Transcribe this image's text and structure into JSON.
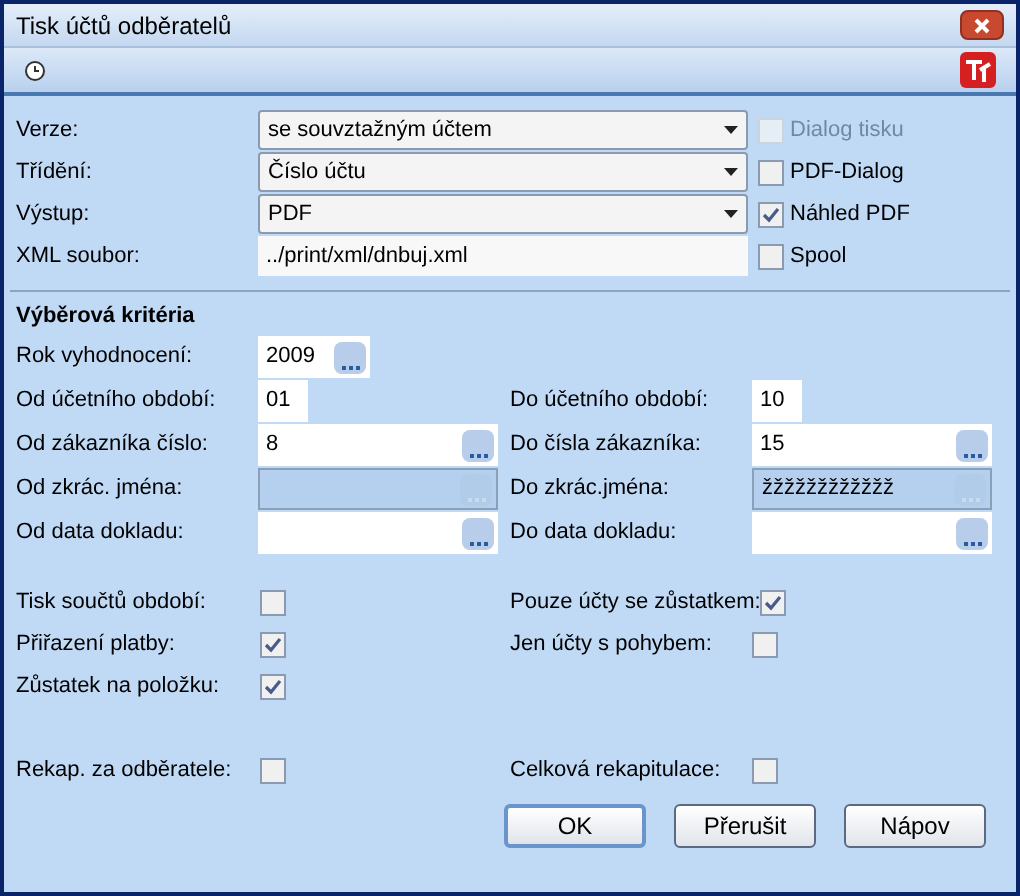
{
  "window": {
    "title": "Tisk účtů odběratelů"
  },
  "settings": [
    {
      "label": "Verze:",
      "kind": "combo",
      "value": "se souvztažným účtem",
      "option": {
        "label": "Dialog tisku",
        "checked": false,
        "disabled": true
      }
    },
    {
      "label": "Třídění:",
      "kind": "combo",
      "value": "Číslo účtu",
      "option": {
        "label": "PDF-Dialog",
        "checked": false,
        "disabled": false
      }
    },
    {
      "label": "Výstup:",
      "kind": "combo",
      "value": "PDF",
      "option": {
        "label": "Náhled PDF",
        "checked": true,
        "disabled": false
      }
    },
    {
      "label": "XML soubor:",
      "kind": "text",
      "value": "../print/xml/dnbuj.xml",
      "option": {
        "label": "Spool",
        "checked": false,
        "disabled": false
      }
    }
  ],
  "criteria": {
    "title": "Výběrová kritéria",
    "rows": [
      [
        {
          "label": "Rok vyhodnocení:",
          "kind": "year",
          "value": "2009",
          "disabled": false
        }
      ],
      [
        {
          "label": "Od účetního období:",
          "kind": "period",
          "value": "01",
          "disabled": false
        },
        {
          "label": "Do účetního období:",
          "kind": "period",
          "value": "10",
          "disabled": false
        }
      ],
      [
        {
          "label": "Od zákazníka číslo:",
          "kind": "range",
          "value": "8",
          "disabled": false
        },
        {
          "label": "Do čísla zákazníka:",
          "kind": "range",
          "value": "15",
          "disabled": false
        }
      ],
      [
        {
          "label": "Od zkrác. jména:",
          "kind": "range",
          "disabled": true
        },
        {
          "label": "Do zkrác.jména:",
          "kind": "range",
          "value": "žžžžžžžžžžžž",
          "disabled": true
        }
      ],
      [
        {
          "label": "Od data dokladu:",
          "kind": "range",
          "disabled": false
        },
        {
          "label": "Do data dokladu:",
          "kind": "range",
          "disabled": false
        }
      ]
    ]
  },
  "flags": [
    [
      {
        "label": "Tisk součtů období:",
        "checked": false
      },
      {
        "label": "Pouze účty se zůstatkem:",
        "checked": true
      }
    ],
    [
      {
        "label": "Přiřazení platby:",
        "checked": true
      },
      {
        "label": "Jen účty s pohybem:",
        "checked": false
      }
    ],
    [
      {
        "label": "Zůstatek na položku:",
        "checked": true
      }
    ]
  ],
  "summary": [
    {
      "label": "Rekap. za odběratele:",
      "checked": false
    },
    {
      "label": "Celková rekapitulace:",
      "checked": false
    }
  ],
  "buttons": [
    {
      "label": "OK",
      "default": true
    },
    {
      "label": "Přerušit",
      "default": false
    },
    {
      "label": "Nápov",
      "default": false
    }
  ]
}
